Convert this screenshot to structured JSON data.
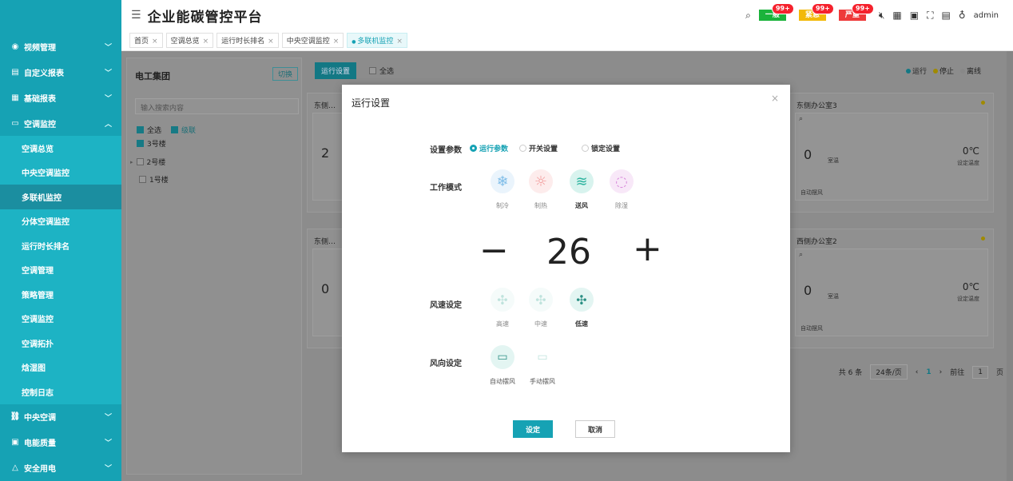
{
  "header": {
    "title": "企业能碳管控平台",
    "alarms": [
      {
        "label": "一般",
        "badge": "99+",
        "color": "#1bb33b"
      },
      {
        "label": "紧急",
        "badge": "99+",
        "color": "#f2b90a"
      },
      {
        "label": "严重",
        "badge": "99+",
        "color": "#ee3a3a"
      }
    ],
    "user": "admin"
  },
  "tabs": [
    {
      "label": "首页",
      "active": false
    },
    {
      "label": "空调总览",
      "active": false
    },
    {
      "label": "运行时长排名",
      "active": false
    },
    {
      "label": "中央空调监控",
      "active": false
    },
    {
      "label": "多联机监控",
      "active": true
    }
  ],
  "sidebar": {
    "groups_top": [
      {
        "label": "视频管理",
        "icon": "camera-icon"
      },
      {
        "label": "自定义报表",
        "icon": "report-icon"
      },
      {
        "label": "基础报表",
        "icon": "table-icon"
      },
      {
        "label": "空调监控",
        "icon": "ac-icon"
      }
    ],
    "sub_items": [
      {
        "label": "空调总览",
        "active": false
      },
      {
        "label": "中央空调监控",
        "active": false
      },
      {
        "label": "多联机监控",
        "active": true
      },
      {
        "label": "分体空调监控",
        "active": false
      },
      {
        "label": "运行时长排名",
        "active": false
      },
      {
        "label": "空调管理",
        "active": false
      },
      {
        "label": "策略管理",
        "active": false
      },
      {
        "label": "空调监控",
        "active": false
      },
      {
        "label": "空调拓扑",
        "active": false
      },
      {
        "label": "焓湿图",
        "active": false
      },
      {
        "label": "控制日志",
        "active": false
      }
    ],
    "groups_bottom": [
      {
        "label": "中央空调",
        "icon": "network-icon"
      },
      {
        "label": "电能质量",
        "icon": "meter-icon"
      },
      {
        "label": "安全用电",
        "icon": "safety-icon"
      }
    ]
  },
  "left_panel": {
    "title": "电工集团",
    "switch_label": "切换",
    "search_placeholder": "输入搜索内容",
    "select_all": "全选",
    "cascade": "级联",
    "tree": [
      "3号楼",
      "2号楼",
      "1号楼"
    ]
  },
  "toolbar": {
    "run_settings": "运行设置",
    "select_all": "全选"
  },
  "legend": [
    {
      "label": "运行",
      "color": "#137884"
    },
    {
      "label": "停止",
      "color": "#a08a00"
    },
    {
      "label": "离线",
      "color": "#888888"
    }
  ],
  "cards": [
    {
      "title": "东侧…",
      "temp": "2"
    },
    {
      "title": "东侧办公室3",
      "temp": "0",
      "set_temp": "0℃",
      "set_label": "设定温度",
      "room_label": "室温",
      "mode_label": "自动摆风"
    },
    {
      "title": "东侧…",
      "temp": "0"
    },
    {
      "title": "西侧办公室2",
      "temp": "0",
      "set_temp": "0℃",
      "set_label": "设定温度",
      "room_label": "室温",
      "mode_label": "自动摆风"
    }
  ],
  "pager": {
    "total": "共 6 条",
    "page_size": "24条/页",
    "current": "1",
    "goto_label": "前往",
    "goto_value": "1",
    "page_suffix": "页"
  },
  "modal": {
    "title": "运行设置",
    "param_label": "设置参数",
    "params": [
      {
        "label": "运行参数",
        "selected": true
      },
      {
        "label": "开关设置",
        "selected": false
      },
      {
        "label": "锁定设置",
        "selected": false
      }
    ],
    "mode_label": "工作模式",
    "modes": [
      {
        "label": "制冷",
        "icon": "snowflake-icon",
        "bg": "#eaf4fc",
        "fg": "#7fbde8",
        "selected": false
      },
      {
        "label": "制热",
        "icon": "sun-icon",
        "bg": "#fdecec",
        "fg": "#f29c9c",
        "selected": false
      },
      {
        "label": "送风",
        "icon": "wind-icon",
        "bg": "#d8f3ee",
        "fg": "#2bb39e",
        "selected": true
      },
      {
        "label": "除湿",
        "icon": "droplet-icon",
        "bg": "#f8e8f8",
        "fg": "#d98bdb",
        "selected": false
      }
    ],
    "temperature": "26",
    "minus": "−",
    "plus": "+",
    "fan_label": "风速设定",
    "fans": [
      {
        "label": "高速",
        "selected": false
      },
      {
        "label": "中速",
        "selected": false
      },
      {
        "label": "低速",
        "selected": true
      }
    ],
    "dir_label": "风向设定",
    "dirs": [
      {
        "label": "自动摆风",
        "selected": true
      },
      {
        "label": "手动摆风",
        "selected": false
      }
    ],
    "confirm": "设定",
    "cancel": "取消"
  }
}
